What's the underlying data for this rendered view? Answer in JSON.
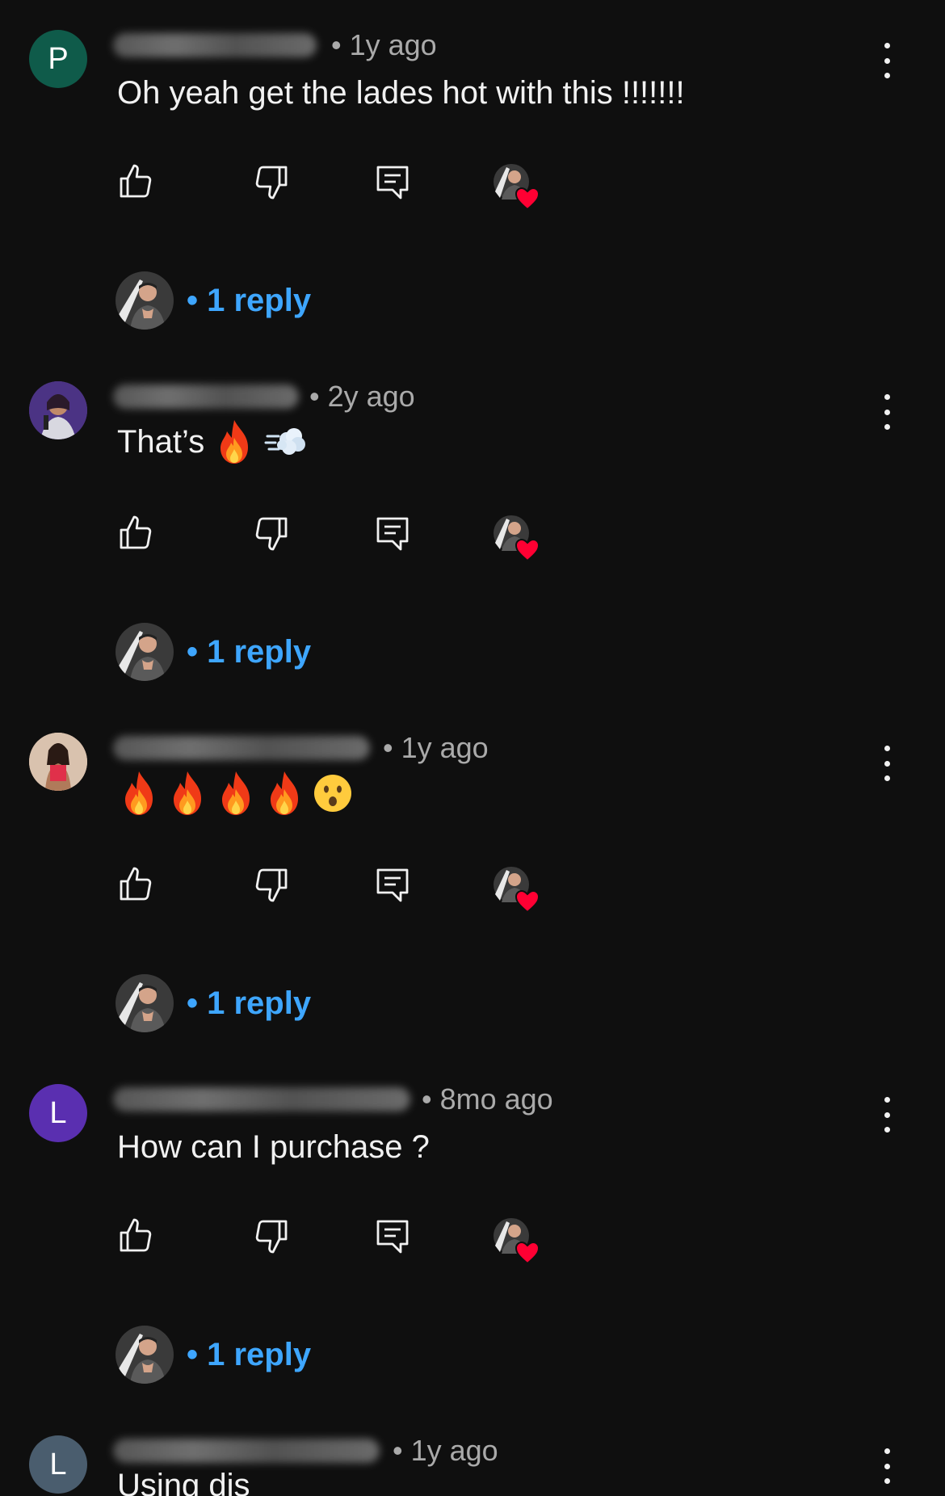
{
  "colors": {
    "background": "#0f0f0f",
    "text": "#f1f1f1",
    "meta": "#aaaaaa",
    "link": "#3ea6ff",
    "heart": "#ff0033"
  },
  "icons": {
    "like": "thumb-up-icon",
    "dislike": "thumb-down-icon",
    "reply": "reply-comment-icon",
    "creator_heart": "creator-heart-icon",
    "more": "more-vertical-icon"
  },
  "comments": [
    {
      "avatar_letter": "P",
      "avatar_color": "#0f5b4a",
      "meta": "• 1y ago",
      "text": "Oh yeah get the lades hot with this !!!!!!!",
      "replies_label": "• 1 reply"
    },
    {
      "avatar_letter": "",
      "avatar_color": "#5a3a8a",
      "meta": "• 2y ago",
      "text": "That’s",
      "emojis": [
        "fire",
        "dash"
      ],
      "replies_label": "• 1 reply"
    },
    {
      "avatar_letter": "",
      "avatar_color": "#c9a38a",
      "meta": "• 1y ago",
      "text": "",
      "emojis": [
        "fire",
        "fire",
        "fire",
        "fire",
        "hushed-face"
      ],
      "replies_label": "• 1 reply"
    },
    {
      "avatar_letter": "L",
      "avatar_color": "#5a2fb0",
      "meta": "• 8mo ago",
      "text": "How can I purchase ?",
      "replies_label": "• 1 reply"
    },
    {
      "avatar_letter": "L",
      "avatar_color": "#4a5d6e",
      "meta": "• 1y ago",
      "text": "Using dis"
    }
  ]
}
